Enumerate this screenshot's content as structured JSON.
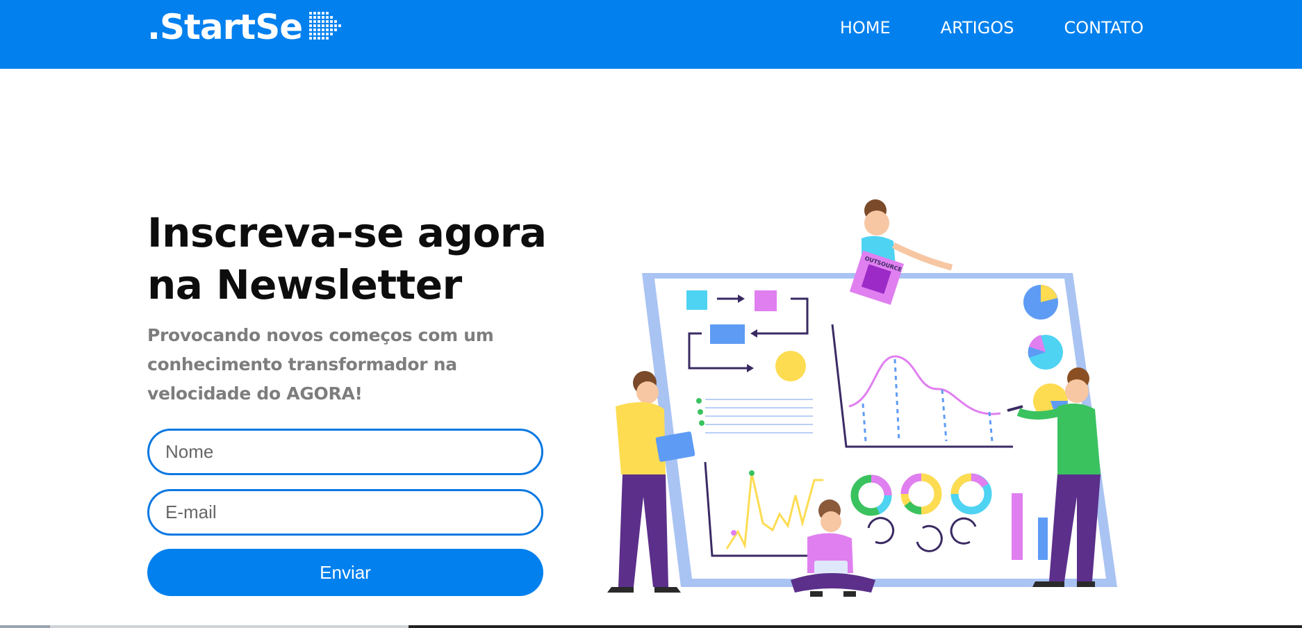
{
  "header": {
    "logo_text": ".StartSe",
    "logo_mark_icon": "arrow-dots-icon",
    "nav": [
      {
        "label": "HOME"
      },
      {
        "label": "ARTIGOS"
      },
      {
        "label": "CONTATO"
      }
    ]
  },
  "hero": {
    "title_line1": "Inscreva-se agora",
    "title_line2": "na Newsletter",
    "subtitle_line1": "Provocando novos começos com um",
    "subtitle_line2": "conhecimento transformador na",
    "subtitle_line3": "velocidade do AGORA!"
  },
  "form": {
    "name_placeholder": "Nome",
    "name_value": "",
    "email_placeholder": "E-mail",
    "email_value": "",
    "submit_label": "Enviar"
  },
  "illustration": {
    "name": "team-analytics-illustration",
    "badge_text": "OUTSOURCE"
  },
  "colors": {
    "brand_blue": "#0180ee",
    "input_border": "#0a78e2",
    "title": "#0d0d0d",
    "subtitle": "#7d7d7d"
  }
}
